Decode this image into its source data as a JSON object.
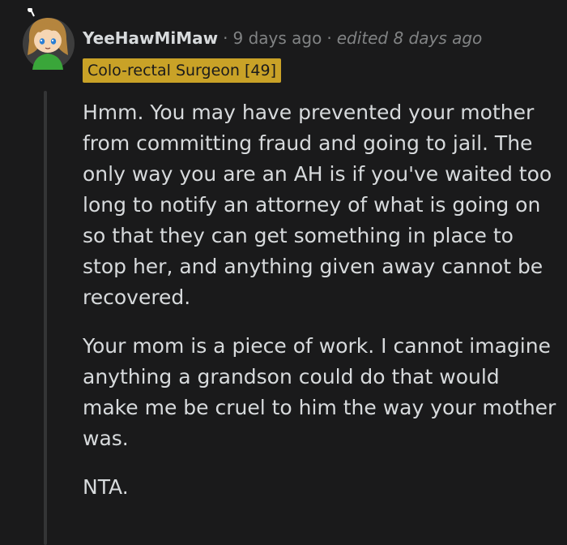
{
  "comment": {
    "author": "YeeHawMiMaw",
    "separator": "·",
    "timestamp": "9 days ago",
    "edited": "edited 8 days ago",
    "flair": "Colo-rectal Surgeon [49]",
    "paragraphs": [
      "Hmm. You may have prevented your mother from committing fraud and going to jail. The only way you are an AH is if you've waited too long to notify an attorney of what is going on so that they can get something in place to stop her, and anything given away cannot be recovered.",
      "Your mom is a piece of work. I cannot imagine anything a grandson could do that would make me be cruel to him the way your mother was.",
      "NTA."
    ]
  },
  "avatar": {
    "icon": "cartoon-avatar-icon",
    "colors": {
      "background": "#3d3d3d",
      "hair": "#b5853e",
      "skin": "#f6d6b4",
      "shirt": "#3aa63a",
      "eyes": "#2a7fd4"
    }
  },
  "colors": {
    "background": "#1a1a1b",
    "text": "#d7dadc",
    "meta": "#818384",
    "flair_bg": "#c9a227",
    "thread_line": "#343536"
  }
}
